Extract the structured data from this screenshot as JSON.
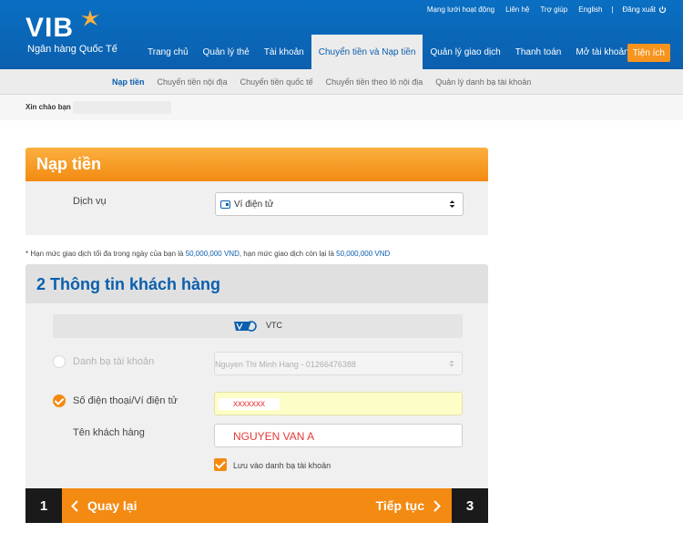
{
  "brand": {
    "logo_text": "VIB",
    "tagline": "Ngân hàng Quốc Tế",
    "accent": "#f38a12",
    "primary": "#0b5fae"
  },
  "top_links": [
    "Mạng lưới hoạt động",
    "Liên hệ",
    "Trợ giúp",
    "English"
  ],
  "logout_label": "Đăng xuất",
  "main_nav": [
    "Trang chủ",
    "Quản lý thẻ",
    "Tài khoản",
    "Chuyển tiền và Nạp tiền",
    "Quản lý giao dịch",
    "Thanh toán",
    "Mở tài khoản"
  ],
  "main_nav_active": "Chuyển tiền và Nạp tiền",
  "utility_label": "Tiện ích",
  "sub_nav": [
    "Nạp tiền",
    "Chuyển tiền nội địa",
    "Chuyển tiền quốc tế",
    "Chuyển tiền theo lô nội địa",
    "Quản lý danh bạ tài khoản"
  ],
  "sub_nav_active": "Nạp tiền",
  "greeting": "Xin chào bạn",
  "panel1": {
    "title": "Nạp tiền",
    "service_label": "Dịch vụ",
    "service_value": "Ví điện tử"
  },
  "limit_note": {
    "prefix": "* Hạn mức giao dịch tối đa trong ngày của bạn là ",
    "max_amount": "50,000,000 VND",
    "middle": ", hạn mức giao dịch còn lại là ",
    "remaining_amount": "50,000,000 VND"
  },
  "panel2": {
    "title": "2 Thông tin khách hàng",
    "provider_name": "VTC",
    "contacts_label": "Danh bạ tài khoản",
    "contacts_value": "Nguyen Thi Minh Hang - 01266476388",
    "phone_label": "Số điện thoại/Ví điện tử",
    "phone_value": "xxxxxxx",
    "customer_name_label": "Tên khách hàng",
    "customer_name_value": "NGUYEN VAN A",
    "save_label": "Lưu vào danh bạ tài khoản"
  },
  "steps": {
    "current": "1",
    "next": "3",
    "back_label": "Quay lại",
    "continue_label": "Tiếp tục"
  }
}
